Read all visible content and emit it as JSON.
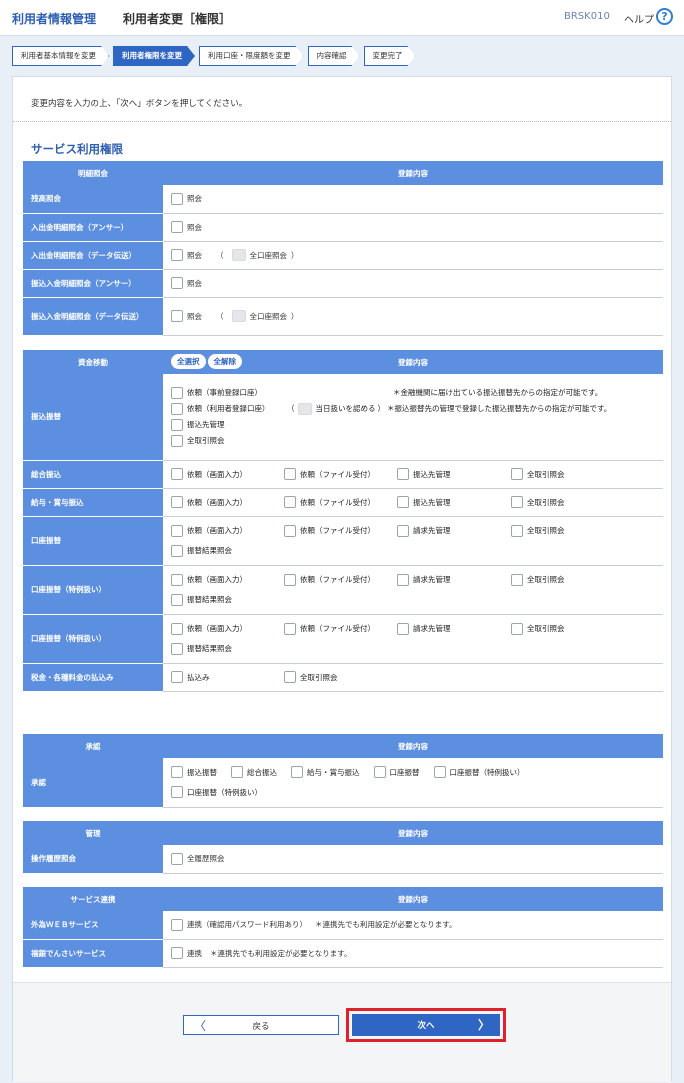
{
  "header": {
    "app_title": "利用者情報管理",
    "page_title": "利用者変更［権限］",
    "screen_code": "BRSK010",
    "help_label": "ヘルプ",
    "help_icon": "?"
  },
  "steps": [
    "利用者基本情報を変更",
    "利用者権限を変更",
    "利用口座・限度額を変更",
    "内容確認",
    "変更完了"
  ],
  "instruction": "変更内容を入力の上、「次へ」ボタンを押してください。",
  "section_title": "サービス利用権限",
  "inquiry": {
    "header_left": "明細照会",
    "header_right": "登録内容",
    "rows": [
      {
        "label": "残高照会",
        "opt": "照会"
      },
      {
        "label": "入出金明細照会（アンサー）",
        "opt": "照会"
      },
      {
        "label": "入出金明細照会（データ伝送）",
        "opt": "照会",
        "paren_open": "（",
        "extra": "全口座照会",
        "paren_close": "）"
      },
      {
        "label": "振込入金明細照会（アンサー）",
        "opt": "照会"
      },
      {
        "label": "振込入金明細照会（データ伝送）",
        "opt": "照会",
        "paren_open": "（",
        "extra": "全口座照会",
        "paren_close": "）"
      }
    ]
  },
  "transfer": {
    "header_left": "資金移動",
    "select_all": "全選択",
    "clear_all": "全解除",
    "header_right": "登録内容",
    "furikomi": {
      "label": "振込振替",
      "lines": [
        {
          "opt": "依頼（事前登録口座）",
          "note": "＊金融機関に届け出ている振込振替先からの指定が可能です。"
        },
        {
          "opt": "依頼（利用者登録口座）",
          "paren_open": "（",
          "extra": "当日扱いを認める",
          "paren_close": "）",
          "note": "＊振込振替先の管理で登録した振込振替先からの指定が可能です。"
        },
        {
          "opt": "振込先管理"
        },
        {
          "opt": "全取引照会"
        }
      ]
    },
    "sogo": {
      "label": "総合振込",
      "opts": [
        "依頼（画面入力）",
        "依頼（ファイル受付）",
        "振込先管理",
        "全取引照会"
      ]
    },
    "kyuyo": {
      "label": "給与・賞与振込",
      "opts": [
        "依頼（画面入力）",
        "依頼（ファイル受付）",
        "振込先管理",
        "全取引照会"
      ]
    },
    "koza1": {
      "label": "口座振替",
      "opts": [
        "依頼（画面入力）",
        "依頼（ファイル受付）",
        "請求先管理",
        "全取引照会"
      ],
      "extra": "振替結果照会"
    },
    "koza2": {
      "label": "口座振替（特例扱い）",
      "opts": [
        "依頼（画面入力）",
        "依頼（ファイル受付）",
        "請求先管理",
        "全取引照会"
      ],
      "extra": "振替結果照会"
    },
    "koza3": {
      "label": "口座振替（特例扱い）",
      "opts": [
        "依頼（画面入力）",
        "依頼（ファイル受付）",
        "請求先管理",
        "全取引照会"
      ],
      "extra": "振替結果照会"
    },
    "tax": {
      "label": "税金・各種料金の払込み",
      "opts": [
        "払込み",
        "全取引照会"
      ]
    }
  },
  "approval": {
    "header_left": "承認",
    "header_right": "登録内容",
    "label": "承認",
    "opts": [
      "振込振替",
      "総合振込",
      "給与・賞与振込",
      "口座振替",
      "口座振替（特例扱い）"
    ],
    "opt2": "口座振替（特例扱い）"
  },
  "admin": {
    "header_left": "管理",
    "header_right": "登録内容",
    "label": "操作履歴照会",
    "opt": "全履歴照会"
  },
  "linkage": {
    "header_left": "サービス連携",
    "header_right": "登録内容",
    "rows": [
      {
        "label": "外為ＷＥＢサービス",
        "opt": "連携（確認用パスワード利用あり）",
        "note": "＊連携先でも利用設定が必要となります。"
      },
      {
        "label": "福銀でんさいサービス",
        "opt": "連携",
        "note": "＊連携先でも利用設定が必要となります。"
      }
    ]
  },
  "buttons": {
    "back": "戻る",
    "next": "次へ",
    "back_arrow": "〈",
    "next_arrow": "〉"
  }
}
